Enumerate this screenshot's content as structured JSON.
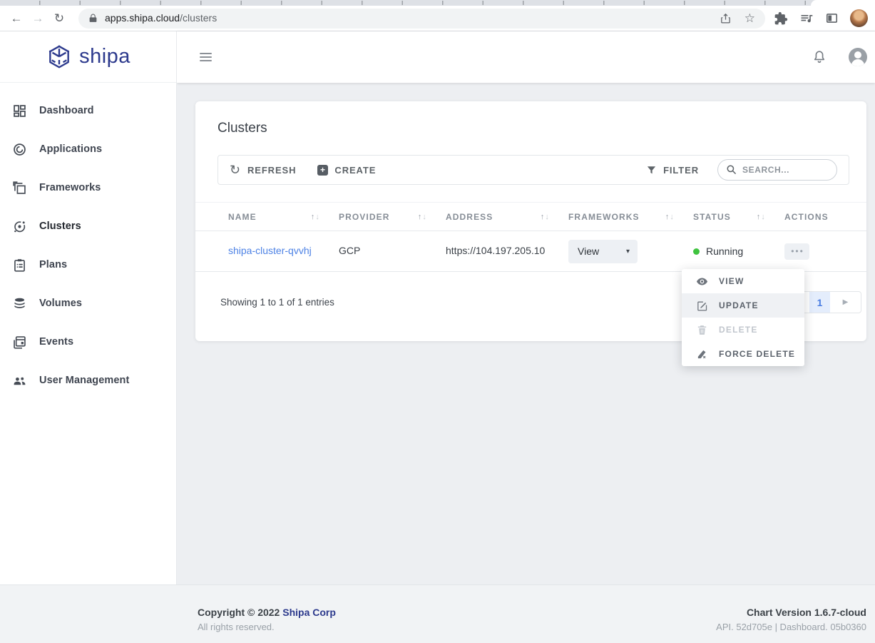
{
  "browser": {
    "url": {
      "host": "apps.shipa.cloud",
      "path": "/clusters"
    }
  },
  "icons": {
    "back_arrow": "←",
    "forward_arrow": "→",
    "reload": "↻",
    "star": "☆",
    "plus": "+",
    "sort_up": "↑",
    "sort_down": "↓",
    "caret_down": "▾",
    "dots": "•••",
    "page_prev": "◀",
    "page_next": "▶"
  },
  "sidebar": {
    "logo": "shipa",
    "items": [
      {
        "label": "Dashboard",
        "icon": "dashboard-grid-icon",
        "active": false
      },
      {
        "label": "Applications",
        "icon": "globe-icon",
        "active": false
      },
      {
        "label": "Frameworks",
        "icon": "stacked-squares-icon",
        "active": false
      },
      {
        "label": "Clusters",
        "icon": "orbit-icon",
        "active": true
      },
      {
        "label": "Plans",
        "icon": "clipboard-icon",
        "active": false
      },
      {
        "label": "Volumes",
        "icon": "database-icon",
        "active": false
      },
      {
        "label": "Events",
        "icon": "calendar-icon",
        "active": false
      },
      {
        "label": "User Management",
        "icon": "people-icon",
        "active": false
      }
    ]
  },
  "page": {
    "title": "Clusters",
    "toolbar": {
      "refresh": "REFRESH",
      "create": "CREATE",
      "filter": "FILTER",
      "search_placeholder": "SEARCH..."
    },
    "table": {
      "columns": [
        "NAME",
        "PROVIDER",
        "ADDRESS",
        "FRAMEWORKS",
        "STATUS",
        "ACTIONS"
      ],
      "row": {
        "name": "shipa-cluster-qvvhj",
        "provider": "GCP",
        "address": "https://104.197.205.10",
        "frameworks_dropdown": "View",
        "status": "Running",
        "status_color": "#3fc33f"
      }
    },
    "summary": "Showing 1 to 1 of 1 entries",
    "pagination": {
      "page": "1"
    }
  },
  "actions_menu": {
    "items": [
      {
        "label": "VIEW",
        "icon": "eye-icon",
        "state": "normal"
      },
      {
        "label": "UPDATE",
        "icon": "edit-icon",
        "state": "hover"
      },
      {
        "label": "DELETE",
        "icon": "trash-icon",
        "state": "disabled"
      },
      {
        "label": "FORCE DELETE",
        "icon": "force-delete-icon",
        "state": "normal"
      }
    ]
  },
  "footer": {
    "copyright_prefix": "Copyright © 2022 ",
    "company": "Shipa Corp",
    "rights": "All rights reserved.",
    "chart_version": "Chart Version 1.6.7-cloud",
    "build_info": "API. 52d705e | Dashboard. 05b0360"
  },
  "colors": {
    "brand_indigo": "#2d3a8d",
    "link_blue": "#4d82e5",
    "status_running_green": "#3fc33f",
    "active_page_blue": "#4a7de2",
    "main_background": "#edeff2"
  }
}
